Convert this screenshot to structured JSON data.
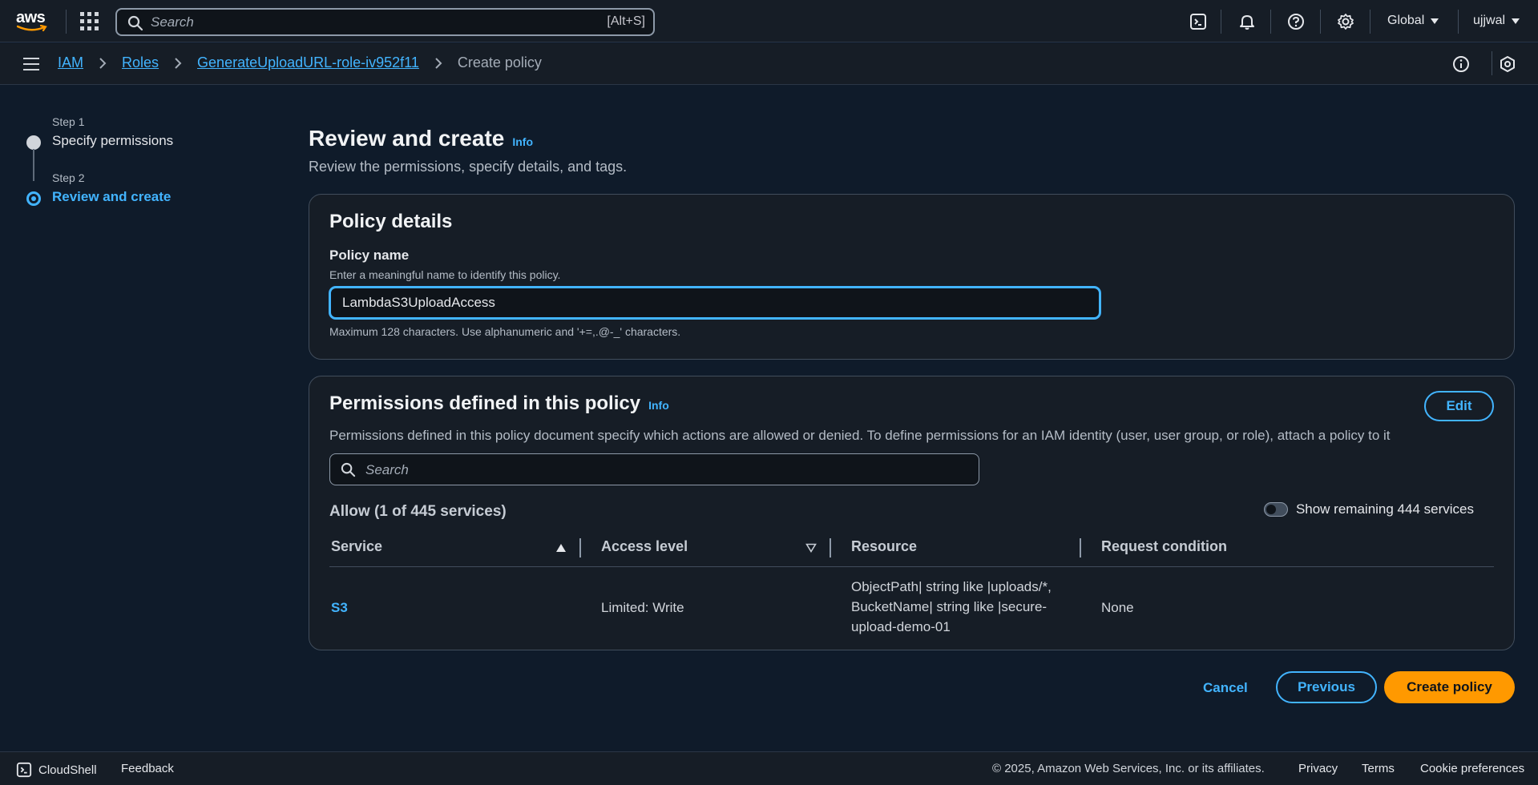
{
  "topnav": {
    "logo_text": "aws",
    "search_placeholder": "Search",
    "search_shortcut": "[Alt+S]",
    "region": "Global",
    "user": "ujjwal"
  },
  "breadcrumb": {
    "items": [
      "IAM",
      "Roles",
      "GenerateUploadURL-role-iv952f11"
    ],
    "current": "Create policy"
  },
  "steps": [
    {
      "number": "Step 1",
      "label": "Specify permissions",
      "active": false
    },
    {
      "number": "Step 2",
      "label": "Review and create",
      "active": true
    }
  ],
  "page": {
    "title": "Review and create",
    "info": "Info",
    "description": "Review the permissions, specify details, and tags."
  },
  "policy_details": {
    "heading": "Policy details",
    "name_label": "Policy name",
    "name_description": "Enter a meaningful name to identify this policy.",
    "name_value": "LambdaS3UploadAccess",
    "name_constraint": "Maximum 128 characters. Use alphanumeric and '+=,.@-_' characters."
  },
  "permissions": {
    "heading": "Permissions defined in this policy",
    "info": "Info",
    "edit_label": "Edit",
    "description": "Permissions defined in this policy document specify which actions are allowed or denied. To define permissions for an IAM identity (user, user group, or role), attach a policy to it",
    "search_placeholder": "Search",
    "allow_count": "Allow (1 of 445 services)",
    "toggle_label": "Show remaining 444 services",
    "columns": [
      "Service",
      "Access level",
      "Resource",
      "Request condition"
    ],
    "rows": [
      {
        "service": "S3",
        "access": "Limited: Write",
        "resource": "ObjectPath| string like |uploads/*, BucketName| string like |secure-upload-demo-01",
        "condition": "None"
      }
    ]
  },
  "actions": {
    "cancel": "Cancel",
    "previous": "Previous",
    "create": "Create policy"
  },
  "footer": {
    "cloudshell": "CloudShell",
    "feedback": "Feedback",
    "copyright": "© 2025, Amazon Web Services, Inc. or its affiliates.",
    "privacy": "Privacy",
    "terms": "Terms",
    "cookies": "Cookie preferences"
  },
  "colors": {
    "accent": "#42b4ff",
    "primary_button": "#ff9900",
    "background": "#0f1b2a",
    "panel": "#161d26"
  }
}
